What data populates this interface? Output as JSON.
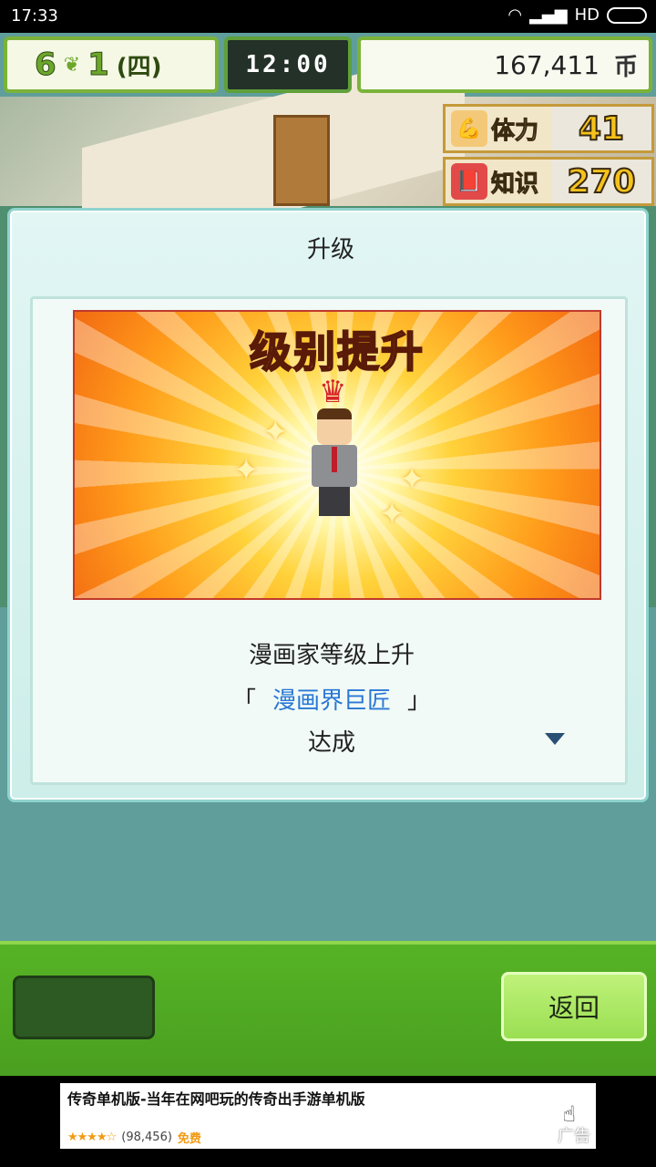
{
  "status_bar": {
    "time": "17:33",
    "network": "HD"
  },
  "hud": {
    "month": "6",
    "week": "1",
    "day": "(四)",
    "time": "12:00",
    "money": "167,411",
    "money_unit": "币",
    "stats": [
      {
        "label": "体力",
        "value": "41"
      },
      {
        "label": "知识",
        "value": "270"
      }
    ]
  },
  "dialog": {
    "title": "升级",
    "banner_title": "级别提升",
    "line1": "漫画家等级上升",
    "bracket_open": "「",
    "rank": "漫画界巨匠",
    "bracket_close": "」",
    "line3": "达成"
  },
  "buttons": {
    "back": "返回"
  },
  "ad": {
    "title": "传奇单机版-当年在网吧玩的传奇出手游单机版",
    "stars": "★★★★☆",
    "rating_count": "(98,456)",
    "price": "免费",
    "label": "广告"
  },
  "colors": {
    "accent_green": "#56b325",
    "rank_blue": "#2a78d4",
    "stat_gold": "#f6c21b"
  }
}
